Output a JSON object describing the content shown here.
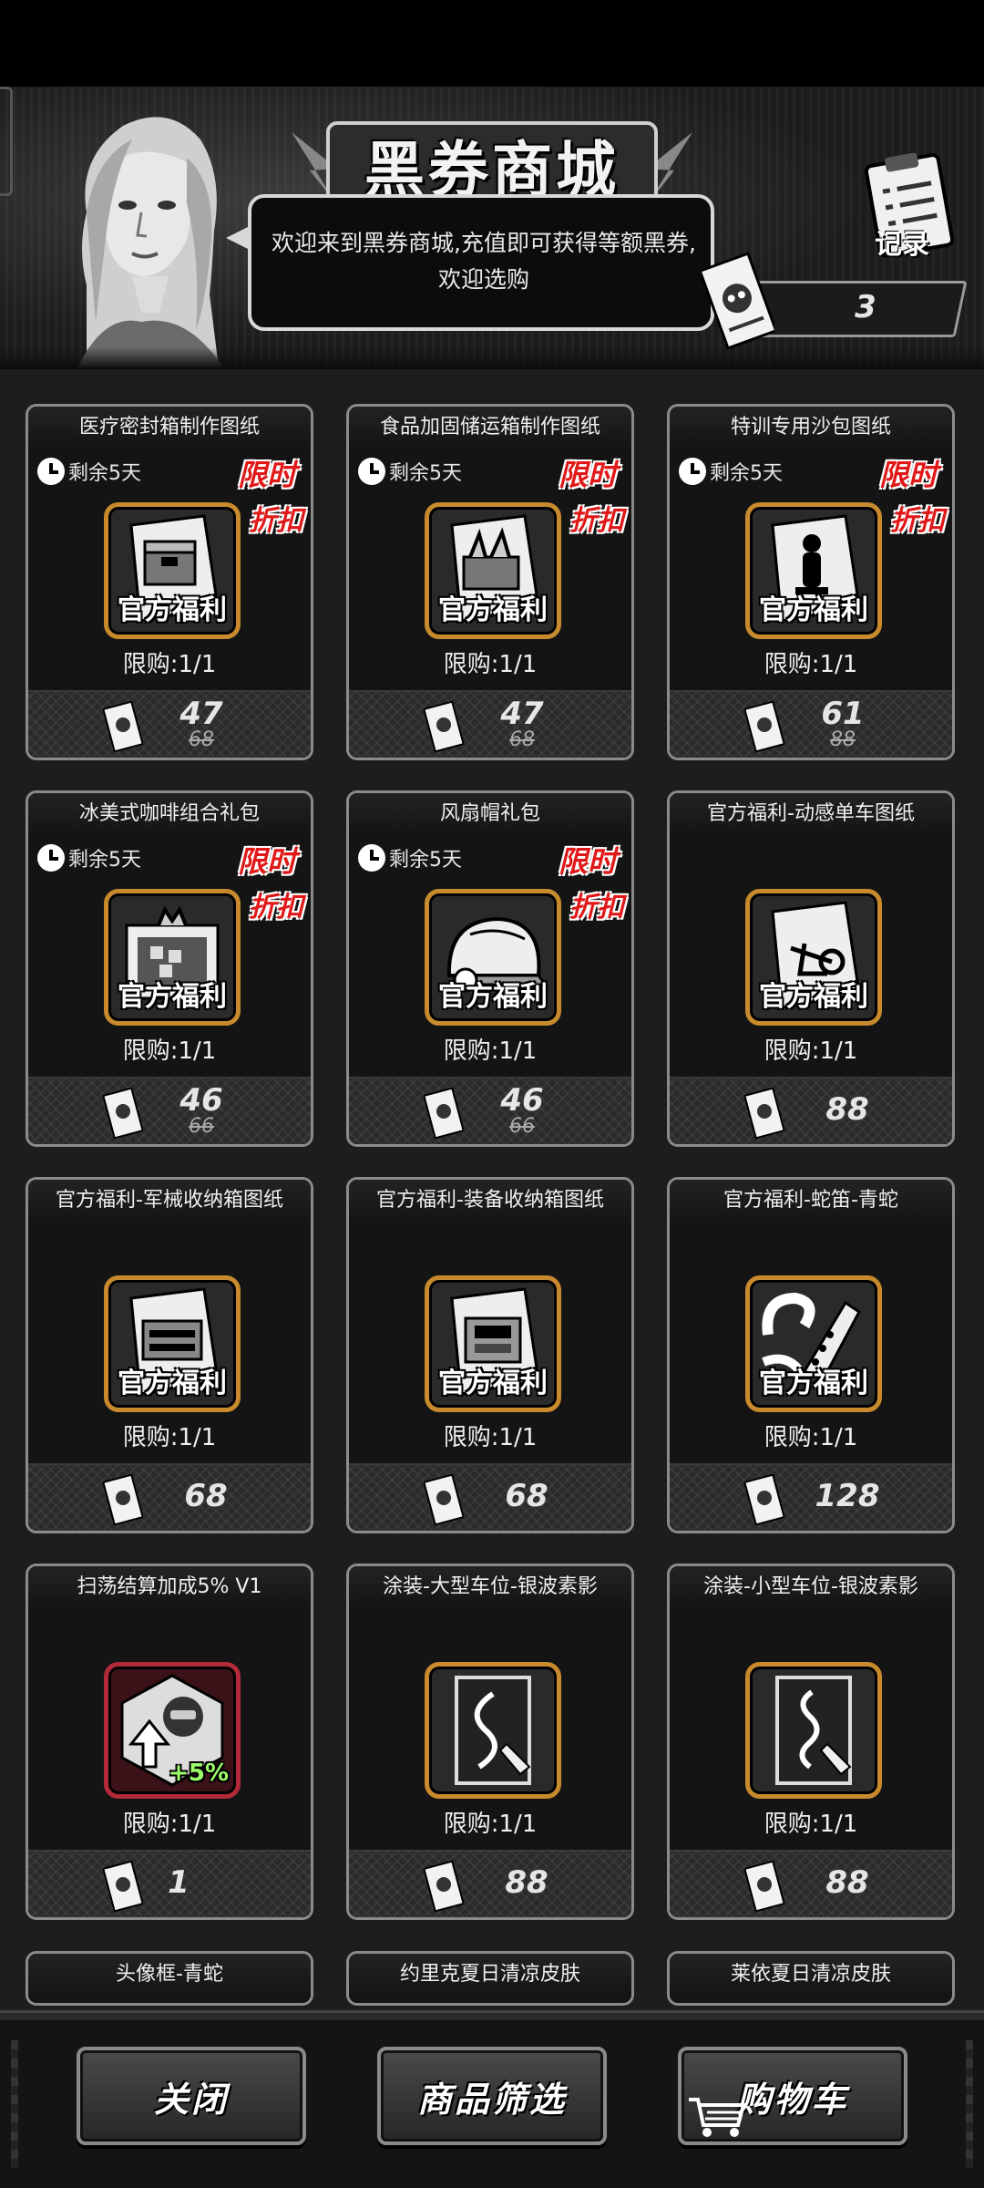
{
  "header": {
    "title": "黑券商城",
    "welcome_text": "欢迎来到黑券商城,充值即可获得等额黑券,欢迎选购",
    "record_label": "记录",
    "currency_balance": "3"
  },
  "items": [
    {
      "title": "医疗密封箱制作图纸",
      "timer": "剩余5天",
      "limited": "限时",
      "discount": "折扣",
      "badge": "官方福利",
      "limit": "限购:1/1",
      "price": "47",
      "old_price": "68",
      "icon": "blueprint-chest-icon"
    },
    {
      "title": "食品加固储运箱制作图纸",
      "timer": "剩余5天",
      "limited": "限时",
      "discount": "折扣",
      "badge": "官方福利",
      "limit": "限购:1/1",
      "price": "47",
      "old_price": "68",
      "icon": "blueprint-food-box-icon"
    },
    {
      "title": "特训专用沙包图纸",
      "timer": "剩余5天",
      "limited": "限时",
      "discount": "折扣",
      "badge": "官方福利",
      "limit": "限购:1/1",
      "price": "61",
      "old_price": "88",
      "icon": "blueprint-sandbag-icon"
    },
    {
      "title": "冰美式咖啡组合礼包",
      "timer": "剩余5天",
      "limited": "限时",
      "discount": "折扣",
      "badge": "官方福利",
      "limit": "限购:1/1",
      "price": "46",
      "old_price": "66",
      "icon": "gift-box-icon"
    },
    {
      "title": "风扇帽礼包",
      "timer": "剩余5天",
      "limited": "限时",
      "discount": "折扣",
      "badge": "官方福利",
      "limit": "限购:1/1",
      "price": "46",
      "old_price": "66",
      "icon": "fan-cap-icon"
    },
    {
      "title": "官方福利-动感单车图纸",
      "badge": "官方福利",
      "limit": "限购:1/1",
      "price": "88",
      "icon": "blueprint-bike-icon"
    },
    {
      "title": "官方福利-军械收纳箱图纸",
      "badge": "官方福利",
      "limit": "限购:1/1",
      "price": "68",
      "icon": "blueprint-armory-box-icon"
    },
    {
      "title": "官方福利-装备收纳箱图纸",
      "badge": "官方福利",
      "limit": "限购:1/1",
      "price": "68",
      "icon": "blueprint-gear-box-icon"
    },
    {
      "title": "官方福利-蛇笛-青蛇",
      "badge": "官方福利",
      "limit": "限购:1/1",
      "price": "128",
      "icon": "snake-flute-icon"
    },
    {
      "title": "扫荡结算加成5% V1",
      "bonus": "+5%",
      "limit": "限购:1/1",
      "price": "1",
      "icon": "bonus-boost-icon"
    },
    {
      "title": "涂装-大型车位-银波素影",
      "limit": "限购:1/1",
      "price": "88",
      "icon": "paint-card-large-icon"
    },
    {
      "title": "涂装-小型车位-银波素影",
      "limit": "限购:1/1",
      "price": "88",
      "icon": "paint-card-small-icon"
    },
    {
      "title": "头像框-青蛇"
    },
    {
      "title": "约里克夏日清凉皮肤"
    },
    {
      "title": "莱依夏日清凉皮肤"
    }
  ],
  "footer": {
    "close_label": "关闭",
    "filter_label": "商品筛选",
    "cart_label": "购物车"
  }
}
